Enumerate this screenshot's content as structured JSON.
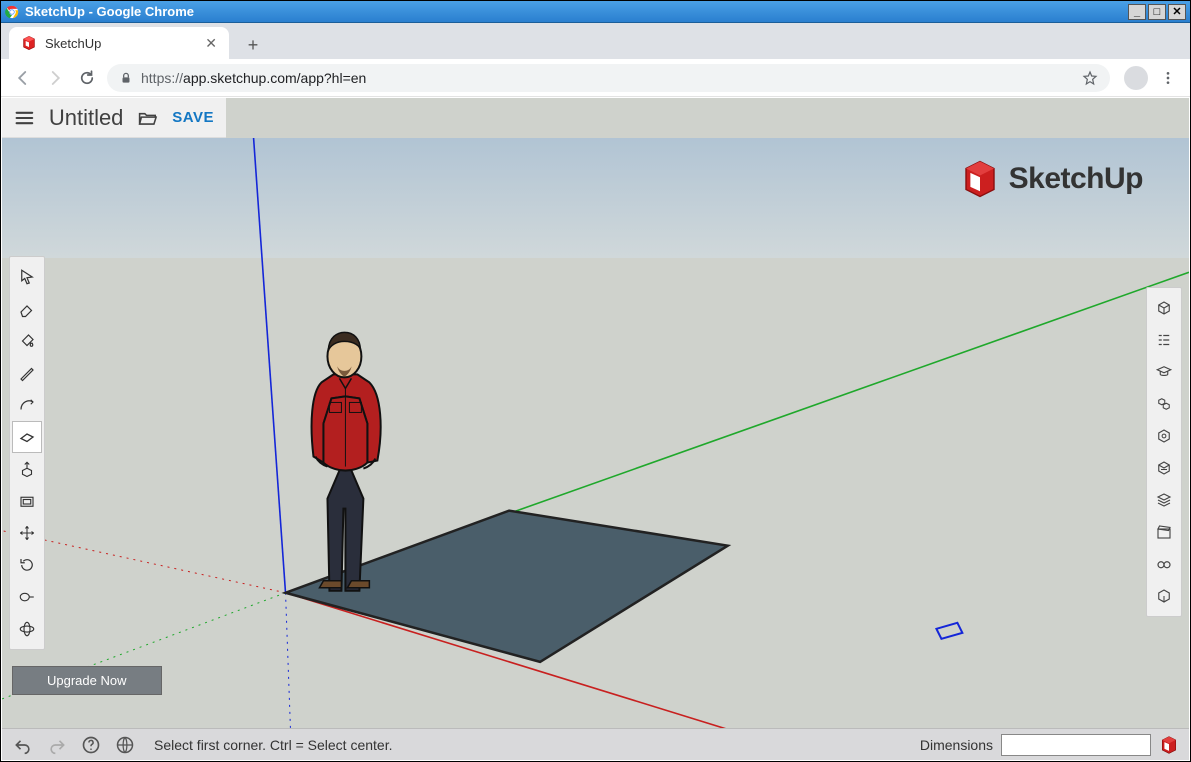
{
  "os_window": {
    "title": "SketchUp - Google Chrome"
  },
  "browser": {
    "tab_title": "SketchUp",
    "url_scheme": "https://",
    "url_host_path": "app.sketchup.com/app?hl=en"
  },
  "app_header": {
    "doc_title": "Untitled",
    "save_label": "SAVE"
  },
  "logo_text": "SketchUp",
  "left_tools": [
    {
      "name": "select-tool",
      "active": false
    },
    {
      "name": "eraser-tool",
      "active": false
    },
    {
      "name": "paint-bucket-tool",
      "active": false
    },
    {
      "name": "line-tool",
      "active": false
    },
    {
      "name": "arc-tool",
      "active": false
    },
    {
      "name": "rectangle-tool",
      "active": true
    },
    {
      "name": "push-pull-tool",
      "active": false
    },
    {
      "name": "offset-tool",
      "active": false
    },
    {
      "name": "move-tool",
      "active": false
    },
    {
      "name": "rotate-tool",
      "active": false
    },
    {
      "name": "tape-measure-tool",
      "active": false
    },
    {
      "name": "orbit-tool",
      "active": false
    }
  ],
  "right_panels": [
    {
      "name": "entity-info-panel"
    },
    {
      "name": "outliner-panel"
    },
    {
      "name": "instructor-panel"
    },
    {
      "name": "components-panel"
    },
    {
      "name": "materials-panel"
    },
    {
      "name": "styles-panel"
    },
    {
      "name": "layers-panel"
    },
    {
      "name": "scenes-panel"
    },
    {
      "name": "display-panel"
    },
    {
      "name": "3d-warehouse-panel"
    }
  ],
  "upgrade_label": "Upgrade Now",
  "statusbar": {
    "hint": "Select first corner. Ctrl = Select center.",
    "dimensions_label": "Dimensions",
    "dimensions_value": ""
  }
}
